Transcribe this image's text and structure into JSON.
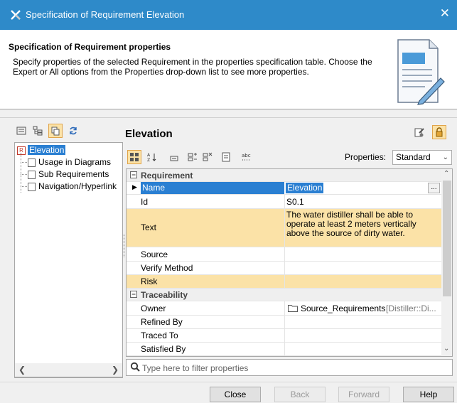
{
  "window": {
    "title": "Specification of Requirement Elevation",
    "close_glyph": "✕"
  },
  "header": {
    "title": "Specification of Requirement properties",
    "description": "Specify properties of the selected Requirement in the properties specification table. Choose the Expert or All options from the Properties drop-down list to see more properties."
  },
  "left_toolbar": {
    "icons": [
      "list-view-icon",
      "tree-view-icon",
      "copy-icon",
      "refresh-icon"
    ]
  },
  "tree": {
    "root": {
      "badge": "R",
      "label": "Elevation"
    },
    "items": [
      {
        "label": "Usage in Diagrams"
      },
      {
        "label": "Sub Requirements"
      },
      {
        "label": "Navigation/Hyperlink"
      }
    ]
  },
  "element_title": "Elevation",
  "properties_label": "Properties:",
  "properties_mode": "Standard",
  "grid": {
    "categories": {
      "requirement": "Requirement",
      "traceability": "Traceability"
    },
    "rows": {
      "name": {
        "label": "Name",
        "value": "Elevation",
        "ellipsis": "..."
      },
      "id": {
        "label": "Id",
        "value": "S0.1"
      },
      "text": {
        "label": "Text",
        "value": "The water distiller shall be able to operate at least 2 meters vertically above the source of dirty water."
      },
      "source": {
        "label": "Source",
        "value": ""
      },
      "verify_method": {
        "label": "Verify Method",
        "value": ""
      },
      "risk": {
        "label": "Risk",
        "value": ""
      },
      "owner": {
        "label": "Owner",
        "value": "Source_Requirements",
        "value_suffix": "[Distiller::Di..."
      },
      "refined_by": {
        "label": "Refined By",
        "value": ""
      },
      "traced_to": {
        "label": "Traced To",
        "value": ""
      },
      "satisfied_by": {
        "label": "Satisfied By",
        "value": ""
      }
    }
  },
  "filter": {
    "placeholder": "Type here to filter properties"
  },
  "buttons": {
    "close": "Close",
    "back": "Back",
    "forward": "Forward",
    "help": "Help"
  },
  "colors": {
    "titlebar": "#2e8ac9",
    "highlight": "#fbe2a7",
    "selection": "#2a7fd2"
  }
}
